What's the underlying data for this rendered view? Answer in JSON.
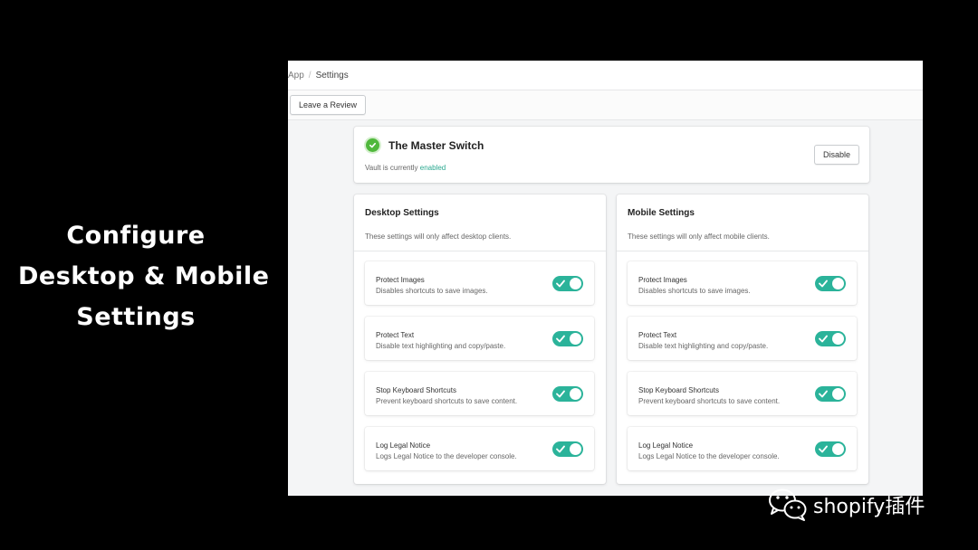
{
  "caption": {
    "line1": "Configure",
    "line2": "Desktop & Mobile",
    "line3": "Settings"
  },
  "breadcrumb": {
    "app": "App",
    "separator": "/",
    "current": "Settings"
  },
  "actions": {
    "review_label": "Leave a Review"
  },
  "master": {
    "title": "The Master Switch",
    "status_prefix": "Vault is currently",
    "status_value": "enabled",
    "disable_label": "Disable",
    "status_color": "#50b83c"
  },
  "desktop": {
    "title": "Desktop Settings",
    "description": "These settings will only affect desktop clients.",
    "options": [
      {
        "title": "Protect Images",
        "desc": "Disables shortcuts to save images.",
        "enabled": true
      },
      {
        "title": "Protect Text",
        "desc": "Disable text highlighting and copy/paste.",
        "enabled": true
      },
      {
        "title": "Stop Keyboard Shortcuts",
        "desc": "Prevent keyboard shortcuts to save content.",
        "enabled": true
      },
      {
        "title": "Log Legal Notice",
        "desc": "Logs Legal Notice to the developer console.",
        "enabled": true
      }
    ]
  },
  "mobile": {
    "title": "Mobile Settings",
    "description": "These settings will only affect mobile clients.",
    "options": [
      {
        "title": "Protect Images",
        "desc": "Disables shortcuts to save images.",
        "enabled": true
      },
      {
        "title": "Protect Text",
        "desc": "Disable text highlighting and copy/paste.",
        "enabled": true
      },
      {
        "title": "Stop Keyboard Shortcuts",
        "desc": "Prevent keyboard shortcuts to save content.",
        "enabled": true
      },
      {
        "title": "Log Legal Notice",
        "desc": "Logs Legal Notice to the developer console.",
        "enabled": true
      }
    ]
  },
  "watermark": {
    "icon": "wechat-icon",
    "text": "shopify插件"
  },
  "colors": {
    "toggle_on": "#2bb39a",
    "enabled_text": "#2aa88f",
    "background": "#000000"
  }
}
